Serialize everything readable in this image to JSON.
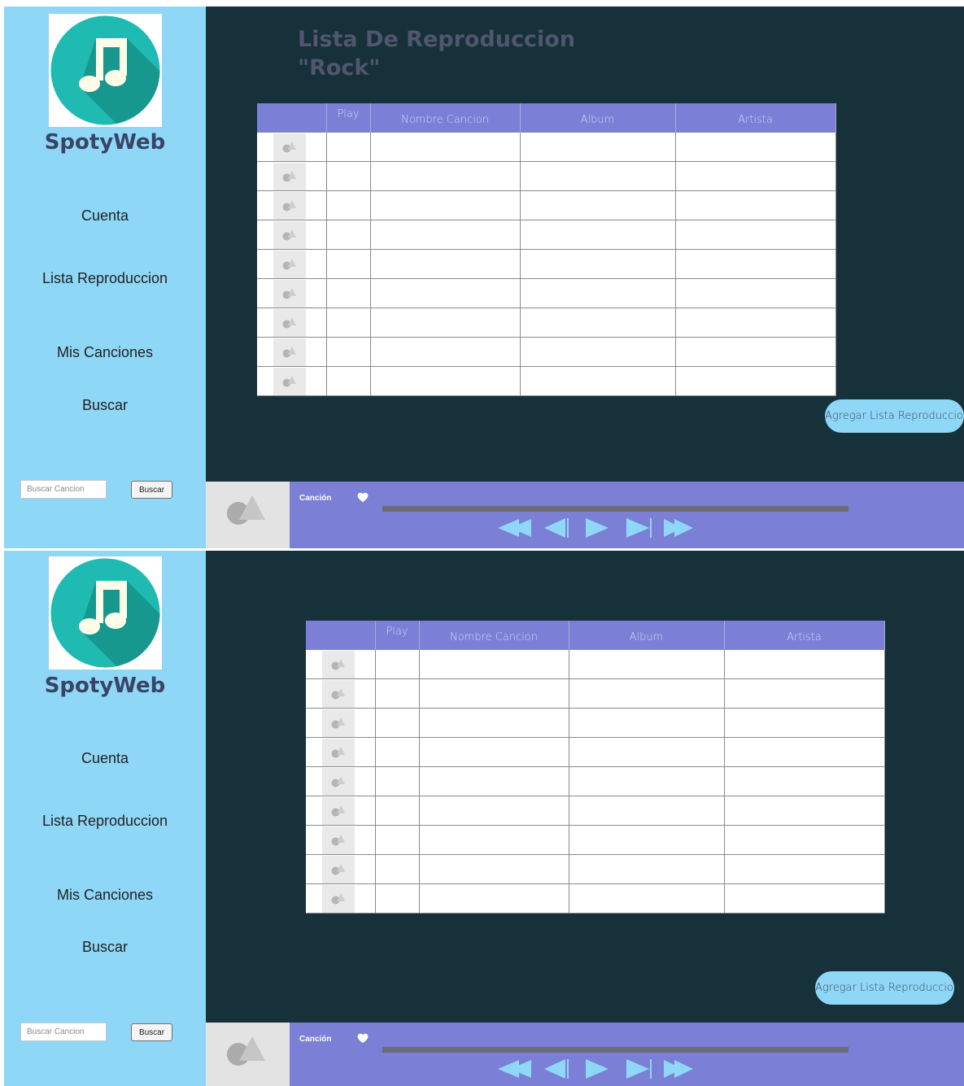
{
  "app": {
    "brand": "SpotyWeb",
    "logo_icon": "music-note-icon",
    "colors": {
      "sidebar": "#8fd7f7",
      "main_bg": "#16313a",
      "accent": "#7b7fd6",
      "brand_text": "#3a4465",
      "logo_circle": "#1fbab2",
      "note": "#fffde7"
    }
  },
  "sidebar": {
    "nav": [
      "Cuenta",
      "Lista Reproduccion",
      "Mis Canciones",
      "Buscar"
    ],
    "search_placeholder": "Buscar Cancion",
    "search_button": "Buscar"
  },
  "playlist": {
    "title": "Lista De Reproduccion\n\"Rock\""
  },
  "table": {
    "columns": [
      "",
      "Play",
      "Nombre Cancion",
      "Album",
      "Artista"
    ],
    "row_count": 9,
    "row_icon": "album-placeholder-icon"
  },
  "actions": {
    "add_playlist": "Agregar Lista Reproduccion"
  },
  "player": {
    "song_label": "Canción",
    "progress": 0,
    "icons": [
      "album-placeholder-icon",
      "heart-icon",
      "rewind-icon",
      "previous-icon",
      "play-icon",
      "next-icon",
      "fast-forward-icon"
    ]
  }
}
